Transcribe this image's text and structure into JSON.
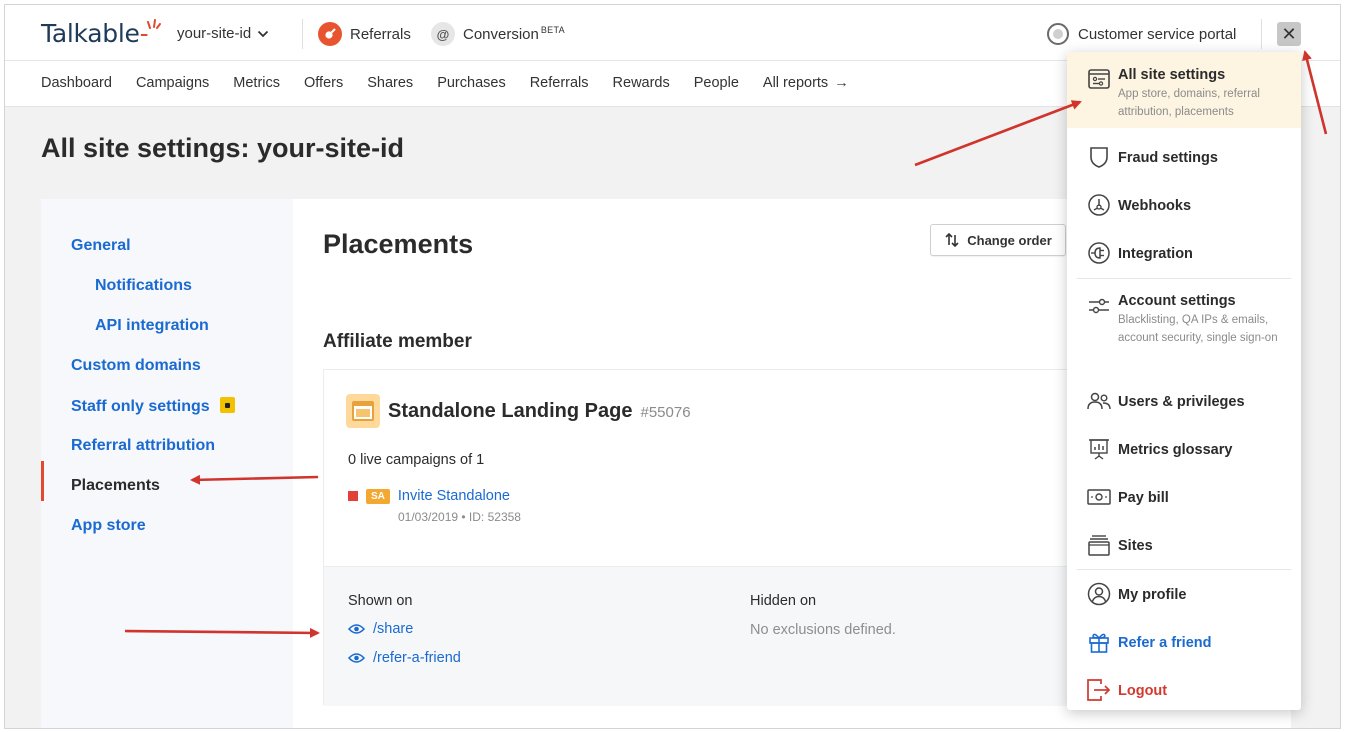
{
  "header": {
    "logo_text": "Talkable",
    "site_id": "your-site-id",
    "products": [
      {
        "label": "Referrals"
      },
      {
        "label": "Conversion",
        "badge": "BETA",
        "icon_glyph": "@"
      }
    ],
    "portal_label": "Customer service portal",
    "close_glyph": "✕"
  },
  "subnav": {
    "items": [
      "Dashboard",
      "Campaigns",
      "Metrics",
      "Offers",
      "Shares",
      "Purchases",
      "Referrals",
      "Rewards",
      "People"
    ],
    "all_reports": "All reports",
    "all_reports_arrow": "→"
  },
  "page_title": "All site settings: your-site-id",
  "sidenav": {
    "items": [
      {
        "label": "General"
      },
      {
        "label": "Notifications"
      },
      {
        "label": "API integration"
      },
      {
        "label": "Custom domains"
      },
      {
        "label": "Staff only settings"
      },
      {
        "label": "Referral attribution"
      },
      {
        "label": "Placements"
      },
      {
        "label": "App store"
      }
    ],
    "active": "Placements"
  },
  "main": {
    "title": "Placements",
    "change_order_label": "Change order",
    "section_title": "Affiliate member",
    "card": {
      "title": "Standalone Landing Page",
      "id": "#55076",
      "live_campaigns": "0 live campaigns of 1",
      "campaign": {
        "badge": "SA",
        "name": "Invite Standalone",
        "meta": "01/03/2019 • ID: 52358",
        "status_color": "#e0413a"
      },
      "shown_on_label": "Shown on",
      "shown_on": [
        "/share",
        "/refer-a-friend"
      ],
      "hidden_on_label": "Hidden on",
      "hidden_on_value": "No exclusions defined."
    }
  },
  "dropdown": {
    "items": [
      {
        "label": "All site settings",
        "desc": "App store, domains, referral attribution, placements",
        "icon": "settings-panel-icon"
      },
      {
        "label": "Fraud settings",
        "icon": "shield-icon"
      },
      {
        "label": "Webhooks",
        "icon": "webhook-icon"
      },
      {
        "label": "Integration",
        "icon": "plug-icon"
      },
      {
        "label": "Account settings",
        "desc": "Blacklisting, QA IPs & emails, account security, single sign-on",
        "icon": "sliders-icon"
      },
      {
        "label": "Users & privileges",
        "icon": "users-icon"
      },
      {
        "label": "Metrics glossary",
        "icon": "presentation-chart-icon"
      },
      {
        "label": "Pay bill",
        "icon": "banknote-icon"
      },
      {
        "label": "Sites",
        "icon": "stack-icon"
      },
      {
        "label": "My profile",
        "icon": "user-circle-icon"
      },
      {
        "label": "Refer a friend",
        "icon": "gift-icon"
      },
      {
        "label": "Logout",
        "icon": "logout-icon"
      }
    ]
  },
  "colors": {
    "accent_blue": "#1a6ad2",
    "brand_orange": "#e14a2e",
    "annotation_red": "#d0342c",
    "highlight": "#fdf5e2"
  }
}
